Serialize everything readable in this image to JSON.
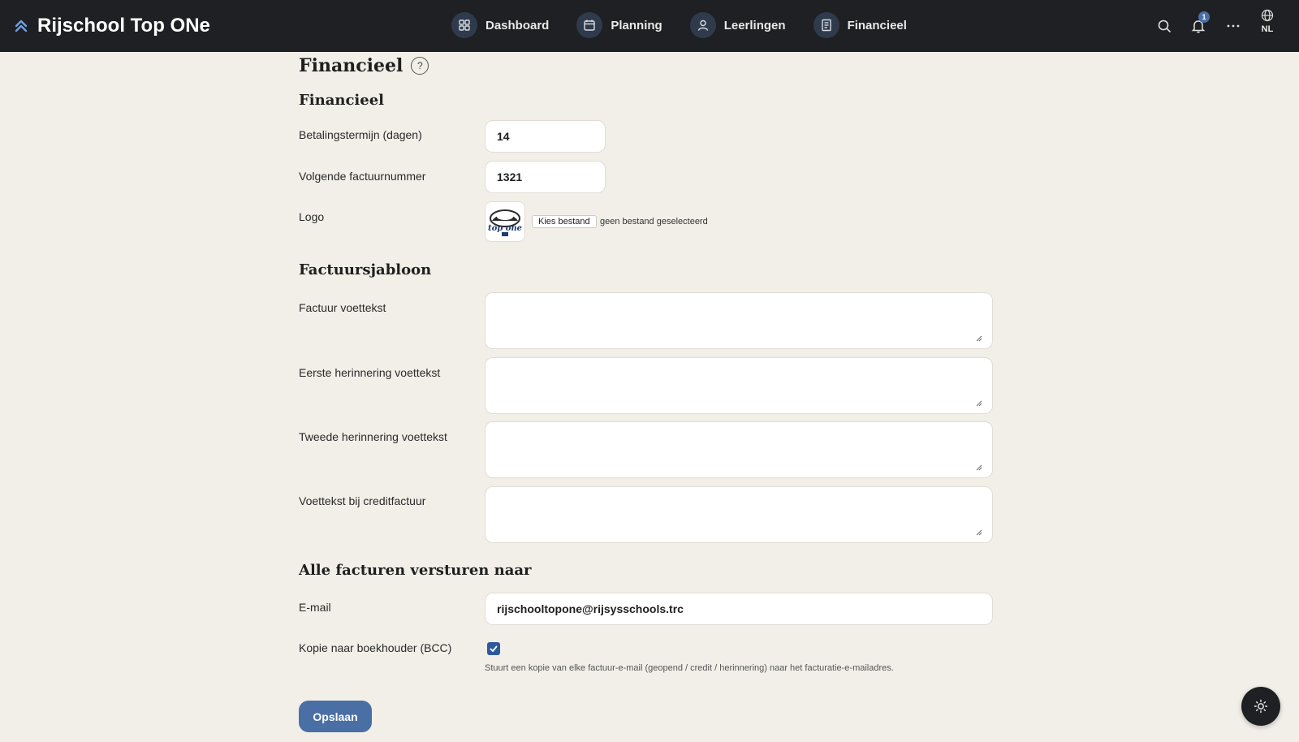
{
  "app": {
    "title": "Rijschool Top ONe"
  },
  "nav": {
    "items": [
      {
        "label": "Dashboard",
        "icon": "dashboard-icon"
      },
      {
        "label": "Planning",
        "icon": "calendar-icon"
      },
      {
        "label": "Leerlingen",
        "icon": "user-icon"
      },
      {
        "label": "Financieel",
        "icon": "receipt-icon"
      }
    ]
  },
  "topbar": {
    "notification_count": "1",
    "language": "NL"
  },
  "page": {
    "title": "Financieel"
  },
  "section_financial": {
    "title": "Financieel",
    "payment_term_label": "Betalingstermijn (dagen)",
    "payment_term_value": "14",
    "next_invoice_label": "Volgende factuurnummer",
    "next_invoice_value": "1321",
    "logo_label": "Logo",
    "file_button": "Kies bestand",
    "file_status": "geen bestand geselecteerd"
  },
  "section_template": {
    "title": "Factuursjabloon",
    "invoice_footer_label": "Factuur voettekst",
    "first_reminder_label": "Eerste herinnering voettekst",
    "second_reminder_label": "Tweede herinnering voettekst",
    "credit_footer_label": "Voettekst bij creditfactuur"
  },
  "section_send": {
    "title": "Alle facturen versturen naar",
    "email_label": "E-mail",
    "email_value": "rijschooltopone@rijsysschools.trc",
    "bcc_label": "Kopie naar boekhouder (BCC)",
    "bcc_checked": true,
    "bcc_hint": "Stuurt een kopie van elke factuur-e-mail (geopend / credit / herinnering) naar het facturatie-e-mailadres."
  },
  "actions": {
    "save_label": "Opslaan"
  },
  "colors": {
    "topbar": "#1f2023",
    "accent": "#4a6fa5",
    "background": "#f2efe9"
  }
}
